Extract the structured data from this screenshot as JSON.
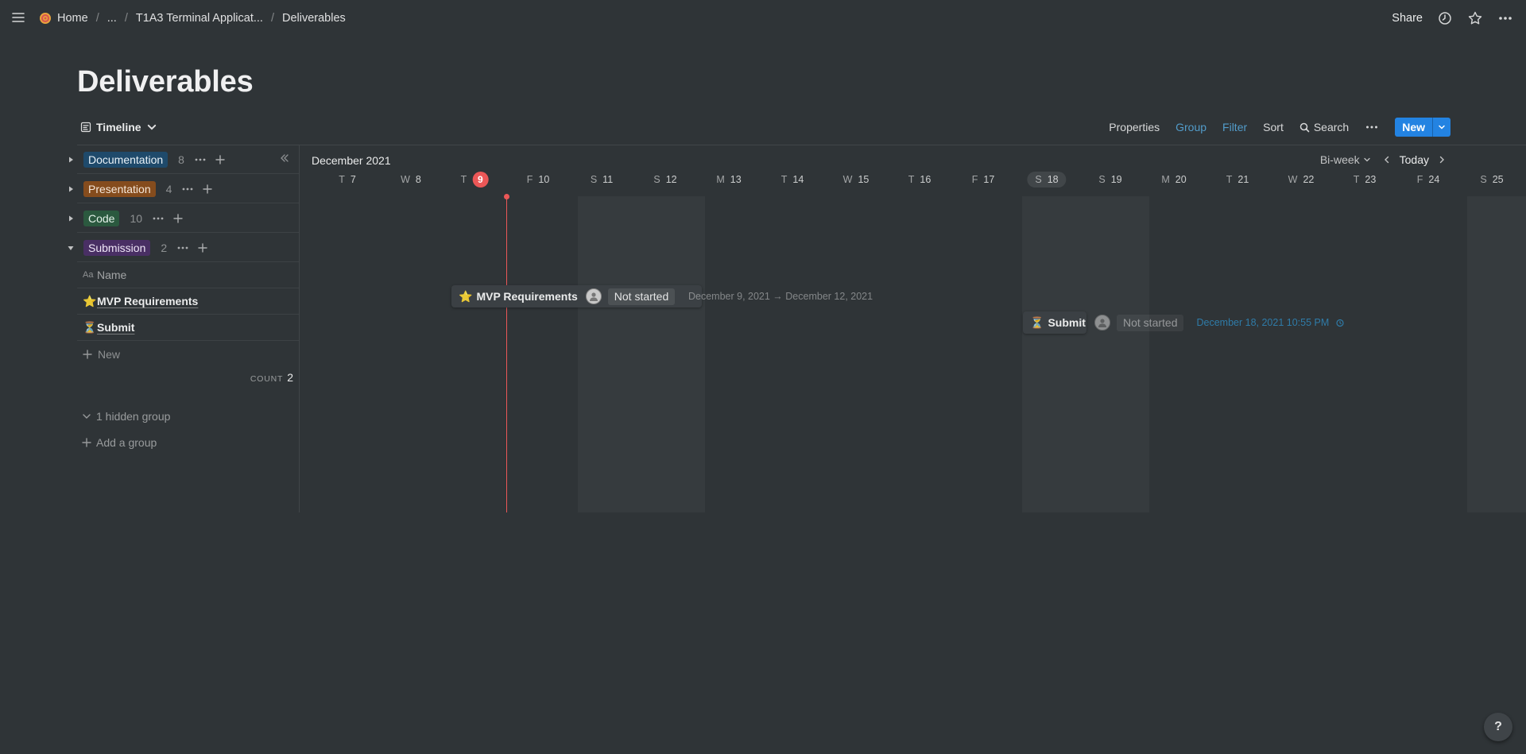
{
  "breadcrumb": {
    "items": [
      "Home",
      "...",
      "T1A3 Terminal Applicat...",
      "Deliverables"
    ]
  },
  "topbar": {
    "share_label": "Share",
    "icons": [
      "menu-icon",
      "clock-icon",
      "star-icon",
      "more-icon"
    ]
  },
  "page": {
    "title": "Deliverables"
  },
  "view": {
    "name": "Timeline",
    "actions": {
      "properties": "Properties",
      "group": "Group",
      "filter": "Filter",
      "sort": "Sort",
      "search": "Search",
      "new": "New"
    },
    "accent_color": "#529cca"
  },
  "groups": [
    {
      "label": "Documentation",
      "count": "8",
      "color": "#1f4a6b"
    },
    {
      "label": "Presentation",
      "count": "4",
      "color": "#854c1d"
    },
    {
      "label": "Code",
      "count": "10",
      "color": "#2b593f"
    },
    {
      "label": "Submission",
      "count": "2",
      "color": "#492f64"
    }
  ],
  "table": {
    "column_header": "Name",
    "column_icon": "Aa",
    "rows": [
      {
        "emoji": "⭐",
        "name": "MVP Requirements"
      },
      {
        "emoji": "⏳",
        "name": "Submit"
      }
    ],
    "new_label": "New",
    "count_label": "COUNT",
    "count_value": "2",
    "hidden_group": "1 hidden group",
    "add_group": "Add a group"
  },
  "timeline": {
    "month": "December 2021",
    "range_label": "Bi-week",
    "today_label": "Today",
    "days": [
      {
        "d": "T",
        "n": "7"
      },
      {
        "d": "W",
        "n": "8"
      },
      {
        "d": "T",
        "n": "9"
      },
      {
        "d": "F",
        "n": "10"
      },
      {
        "d": "S",
        "n": "11"
      },
      {
        "d": "S",
        "n": "12"
      },
      {
        "d": "M",
        "n": "13"
      },
      {
        "d": "T",
        "n": "14"
      },
      {
        "d": "W",
        "n": "15"
      },
      {
        "d": "T",
        "n": "16"
      },
      {
        "d": "F",
        "n": "17"
      },
      {
        "d": "S",
        "n": "18"
      },
      {
        "d": "S",
        "n": "19"
      },
      {
        "d": "M",
        "n": "20"
      },
      {
        "d": "T",
        "n": "21"
      },
      {
        "d": "W",
        "n": "22"
      },
      {
        "d": "T",
        "n": "23"
      },
      {
        "d": "F",
        "n": "24"
      },
      {
        "d": "S",
        "n": "25"
      }
    ],
    "today_color": "#eb5757",
    "cards": [
      {
        "emoji": "⭐",
        "title": "MVP Requirements",
        "status": "Not started",
        "date": "December 9, 2021 → December 12, 2021"
      },
      {
        "emoji": "⏳",
        "title": "Submit",
        "status": "Not started",
        "date": "December 18, 2021 10:55 PM"
      }
    ]
  },
  "help_label": "?"
}
